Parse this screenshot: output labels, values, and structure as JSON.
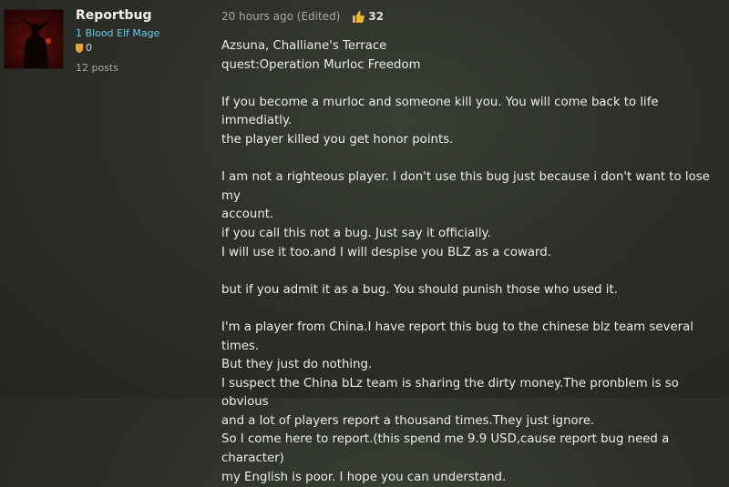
{
  "author": {
    "name": "Reportbug",
    "class": "1 Blood Elf Mage",
    "rank": "0",
    "posts": "12 posts"
  },
  "post": {
    "time": "20 hours ago (Edited)",
    "likes": "32",
    "lines": [
      "Azsuna, Challiane's Terrace",
      "quest:Operation Murloc Freedom",
      "",
      "If you become a murloc and someone kill you. You will come back to life immediatly.",
      "the player killed you get honor points.",
      "",
      "I am not a righteous player. I don't use this bug just because i don't want to lose my",
      "account.",
      "if you call this not a bug. Just say it officially.",
      "I will use it too.and I will despise you BLZ as a coward.",
      "",
      "but if you admit it as a bug. You should punish those who used it.",
      "",
      "I'm a player from China.I have report this bug to the chinese blz team several times.",
      "But they just do nothing.",
      "I suspect the China bLz team is sharing the dirty money.The pronblem is so obvious",
      "and a lot of players report a thousand times.They just ignore.",
      "So I come here to report.(this spend me 9.9 USD,cause report bug need a character)",
      "my English is poor. I hope you can understand."
    ]
  },
  "colors": {
    "class_color": "#69ccf0",
    "rank_icon": "#e8a23a",
    "like_icon": "#f0b429"
  },
  "icons": {
    "rank": "shield-icon",
    "like": "thumbs-up-icon"
  }
}
